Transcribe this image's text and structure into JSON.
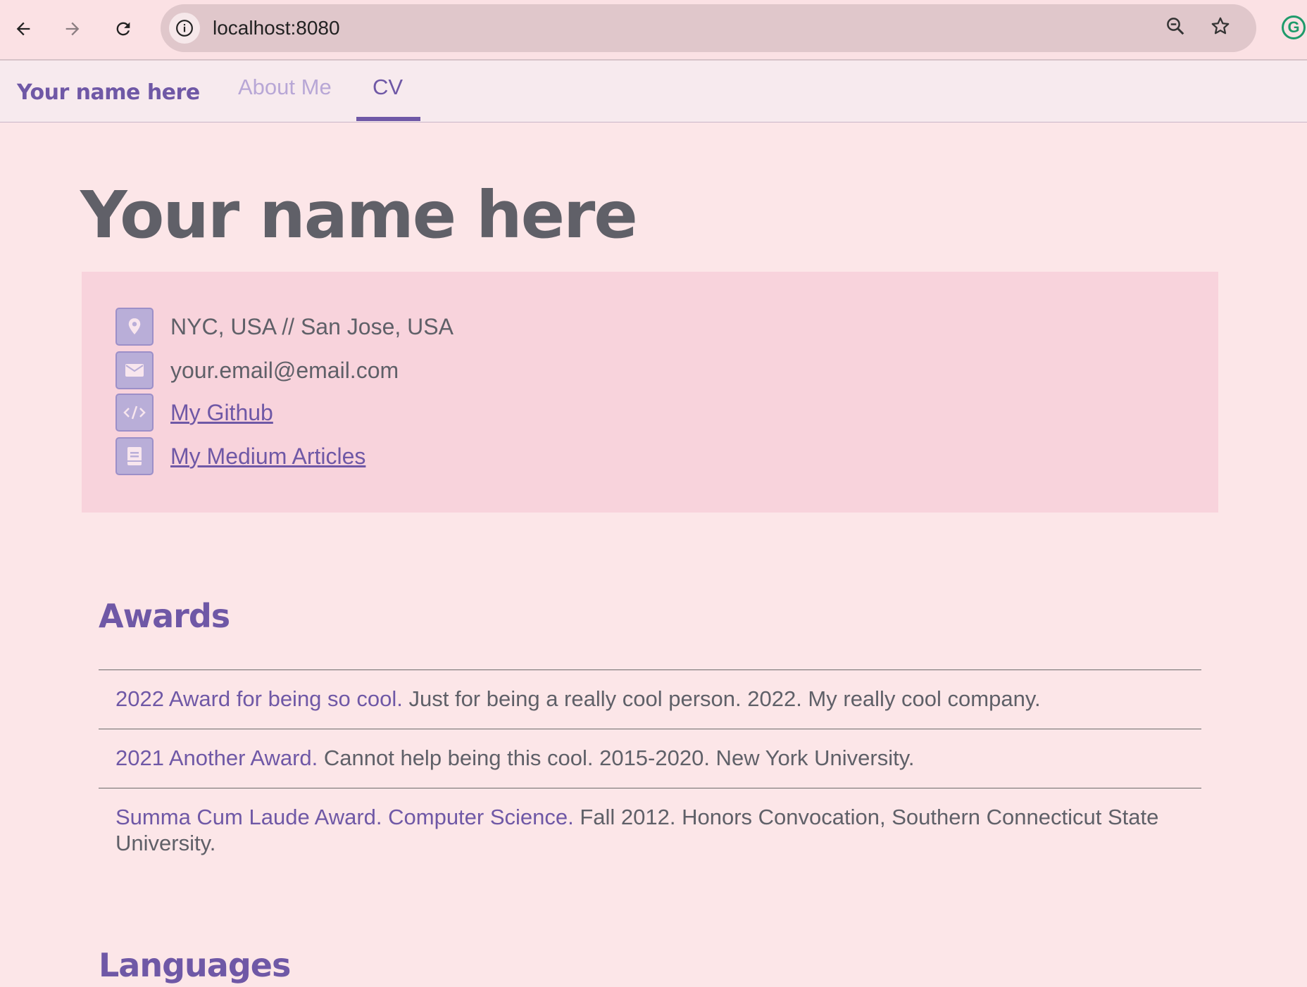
{
  "browser": {
    "url": "localhost:8080",
    "back_icon": "arrow-left-icon",
    "forward_icon": "arrow-right-icon",
    "reload_icon": "reload-icon",
    "zoom_icon": "zoom-icon",
    "bookmark_icon": "star-icon",
    "extension_label": "G"
  },
  "header": {
    "brand": "Your name here",
    "tabs": [
      {
        "label": "About Me",
        "active": false
      },
      {
        "label": "CV",
        "active": true
      }
    ]
  },
  "main": {
    "title": "Your name here",
    "contact": {
      "location": "NYC, USA // San Jose, USA",
      "email": "your.email@email.com",
      "github": "My Github",
      "medium": "My Medium Articles"
    },
    "awards": {
      "heading": "Awards",
      "items": [
        {
          "title": "2022 Award for being so cool.",
          "details": " Just for being a really cool person. 2022. My really cool company."
        },
        {
          "title": "2021 Another Award.",
          "details": " Cannot help being this cool. 2015-2020. New York University."
        },
        {
          "title": "Summa Cum Laude Award. Computer Science.",
          "details": " Fall 2012. Honors Convocation, Southern Connecticut State University."
        }
      ]
    },
    "languages": {
      "heading": "Languages"
    }
  },
  "colors": {
    "accent": "#6f58a6",
    "accent_light": "#b8a7d6",
    "page_bg": "#fce6e8",
    "contact_bg": "#f8d3dc",
    "icon_bg": "#b9aed8",
    "text": "#5f6068"
  }
}
